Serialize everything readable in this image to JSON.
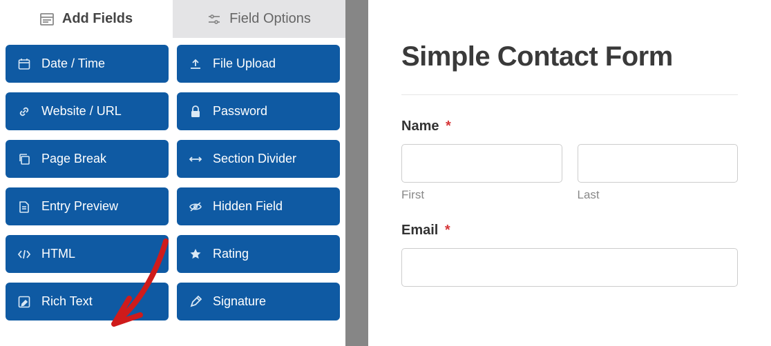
{
  "tabs": {
    "add_fields": "Add Fields",
    "field_options": "Field Options"
  },
  "fields": {
    "date_time": "Date / Time",
    "file_upload": "File Upload",
    "website_url": "Website / URL",
    "password": "Password",
    "page_break": "Page Break",
    "section_divider": "Section Divider",
    "entry_preview": "Entry Preview",
    "hidden_field": "Hidden Field",
    "html": "HTML",
    "rating": "Rating",
    "rich_text": "Rich Text",
    "signature": "Signature"
  },
  "form": {
    "title": "Simple Contact Form",
    "name_label": "Name",
    "first_sub": "First",
    "last_sub": "Last",
    "email_label": "Email",
    "required_mark": "*"
  }
}
